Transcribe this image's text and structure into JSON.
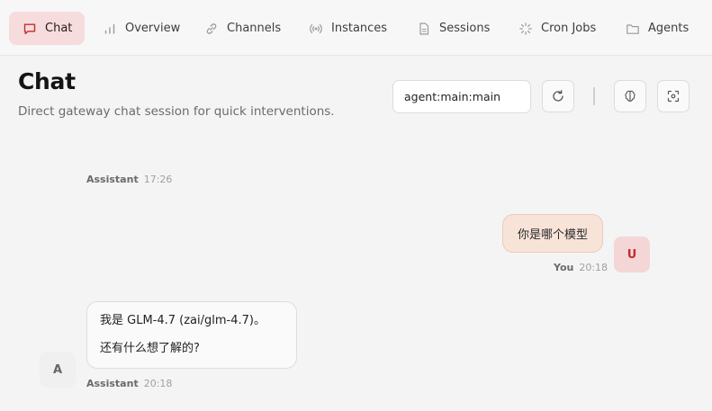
{
  "nav": {
    "tabs": [
      {
        "label": "Chat",
        "icon": "chat-icon",
        "active": true
      },
      {
        "label": "Overview",
        "icon": "bar-chart-icon"
      },
      {
        "label": "Channels",
        "icon": "link-icon"
      },
      {
        "label": "Instances",
        "icon": "radio-icon"
      },
      {
        "label": "Sessions",
        "icon": "document-icon"
      },
      {
        "label": "Cron Jobs",
        "icon": "spinner-icon"
      },
      {
        "label": "Agents",
        "icon": "folder-icon"
      }
    ]
  },
  "header": {
    "title": "Chat",
    "subtitle": "Direct gateway chat session for quick interventions.",
    "session_value": "agent:main:main"
  },
  "messages": {
    "clipped": {
      "who": "Assistant",
      "time": "17:26"
    },
    "user": {
      "text": "你是哪个模型",
      "who": "You",
      "time": "20:18",
      "avatar": "U"
    },
    "assistant": {
      "line1": "我是 GLM-4.7 (zai/glm-4.7)。",
      "line2": "还有什么想了解的?",
      "who": "Assistant",
      "time": "20:18",
      "avatar": "A"
    }
  },
  "colors": {
    "accent": "#c42c2c",
    "active_tab_bg": "#f6dcdc",
    "user_bubble": "#f8e3d8"
  }
}
